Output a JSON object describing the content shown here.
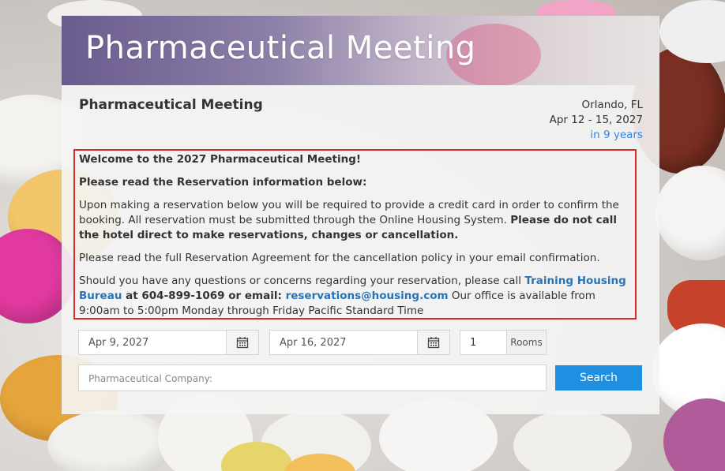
{
  "banner": {
    "title": "Pharmaceutical Meeting"
  },
  "event": {
    "title": "Pharmaceutical Meeting",
    "location": "Orlando, FL",
    "dates": "Apr 12 - 15, 2027",
    "relative": "in 9 years"
  },
  "info": {
    "welcome": "Welcome to the 2027 Pharmaceutical Meeting!",
    "read_below": "Please read the Reservation information below:",
    "para1_text": "Upon making a reservation below you will be required to provide a credit card in order to confirm the booking.  All reservation must be submitted through the Online Housing System.  ",
    "para1_bold": "Please do not call the hotel direct to make reservations, changes or cancellation.",
    "para2": "Please read the full Reservation Agreement for the cancellation policy in your email confirmation.",
    "para3_text": "Should you have any questions or concerns regarding your reservation, please call ",
    "para3_link1": "Training Housing Bureau",
    "para3_bold1": " at 604-899-1069 or email: ",
    "para3_link2": "reservations@housing.com",
    "para3_tail": "  Our office is available from 9:00am to 5:00pm Monday through Friday Pacific Standard Time"
  },
  "form": {
    "checkin": "Apr 9, 2027",
    "checkout": "Apr 16, 2027",
    "rooms_value": "1",
    "rooms_label": "Rooms",
    "company_placeholder": "Pharmaceutical Company:",
    "search_label": "Search"
  },
  "colors": {
    "accent": "#1e8fe1",
    "link": "#2a73b8",
    "relative_date": "#2e86de",
    "info_border": "#d62c2c"
  },
  "icons": {
    "calendar": "calendar-icon"
  }
}
